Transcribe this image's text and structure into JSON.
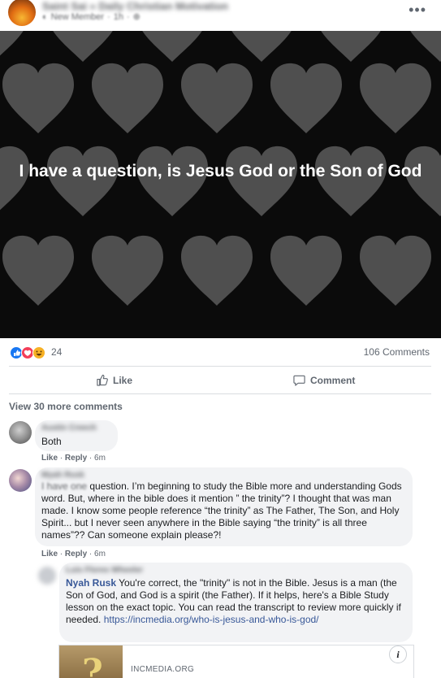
{
  "post": {
    "group_name": "Saint Sai » Daily Christian Motivation",
    "member_badge": "New Member",
    "time": "1h",
    "image_text": "I have a question, is Jesus God or the Son of God"
  },
  "stats": {
    "reactions_count": "24",
    "comments_count": "106 Comments"
  },
  "actions": {
    "like": "Like",
    "comment": "Comment"
  },
  "view_more": "View 30 more comments",
  "comments": [
    {
      "name": "Austin Creech",
      "text": "Both",
      "like": "Like",
      "reply": "Reply",
      "time": "6m"
    },
    {
      "name": "Myah Rusk",
      "text_blurred": "I have one",
      "text": " question. I’m beginning to study the Bible more and understanding Gods word. But, where in the bible does it mention ” the trinity”? I thought that was man made. I know some people reference “the trinity” as The Father, The Son, and Holy Spirit... but I never seen anywhere in the Bible saying “the trinity” is all three names”?? Can someone explain please?!",
      "like": "Like",
      "reply": "Reply",
      "time": "6m"
    },
    {
      "name": "Luis Flores Wheeler",
      "mention": "Nyah Rusk",
      "text": " You're correct, the \"trinity\" is not in the Bible. Jesus is a man (the Son of God, and God is a spirit (the Father). If it helps, here's a Bible Study lesson on the exact topic. You can read the transcript to review more quickly if needed. ",
      "link": "https://incmedia.org/who-is-jesus-and-who-is-god/"
    }
  ],
  "link_preview": {
    "domain": "INCMEDIA.ORG"
  },
  "colors": {
    "accent_link": "#385898",
    "like_blue": "#1877f2",
    "love_red": "#f33e58",
    "haha_yellow": "#f7b125"
  }
}
